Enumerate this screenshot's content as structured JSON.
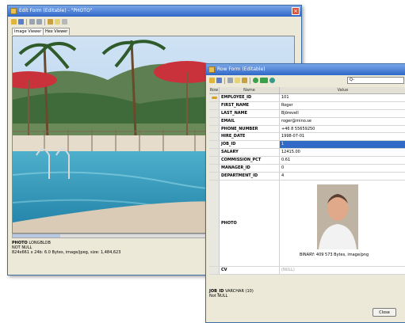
{
  "photo_window": {
    "title": "Edit Form (Editable) - \"PHOTO\"",
    "tabs": [
      "Image Viewer",
      "Hex Viewer"
    ],
    "info": {
      "field": "PHOTO",
      "type": "LONGBLOB",
      "nullable": "NOT NULL",
      "details": "824x661 x 24b: 6.0 Bytes, image/jpeg, size: 1,484,623"
    }
  },
  "form_window": {
    "title": "Row Form (Editable)",
    "search_placeholder": "Q-",
    "columns": {
      "row": "Row",
      "name": "Name",
      "value": "Value"
    },
    "rows": [
      {
        "name": "EMPLOYEE_ID",
        "value": "101"
      },
      {
        "name": "FIRST_NAME",
        "value": "Roger"
      },
      {
        "name": "LAST_NAME",
        "value": "Björevell"
      },
      {
        "name": "EMAIL",
        "value": "roger@mino.se"
      },
      {
        "name": "PHONE_NUMBER",
        "value": "+46 8 55659250"
      },
      {
        "name": "HIRE_DATE",
        "value": "1998-07-01"
      },
      {
        "name": "JOB_ID",
        "value": "1"
      },
      {
        "name": "SALARY",
        "value": "12415.00"
      },
      {
        "name": "COMMISSION_PCT",
        "value": "0.61"
      },
      {
        "name": "MANAGER_ID",
        "value": "0"
      },
      {
        "name": "DEPARTMENT_ID",
        "value": "4"
      }
    ],
    "photo_row": {
      "name": "PHOTO",
      "caption": "BINARY: 409 573 Bytes, image/png"
    },
    "cv_row": {
      "name": "CV",
      "value": "(NULL)"
    },
    "status": {
      "field": "JOB_ID",
      "type": "VARCHAR (10)",
      "nullable": "Not NULL"
    },
    "close_label": "Close"
  },
  "colors": {
    "titlebar": "#2f68c8",
    "selection": "#3169c6",
    "window_bg": "#ece9d8"
  }
}
